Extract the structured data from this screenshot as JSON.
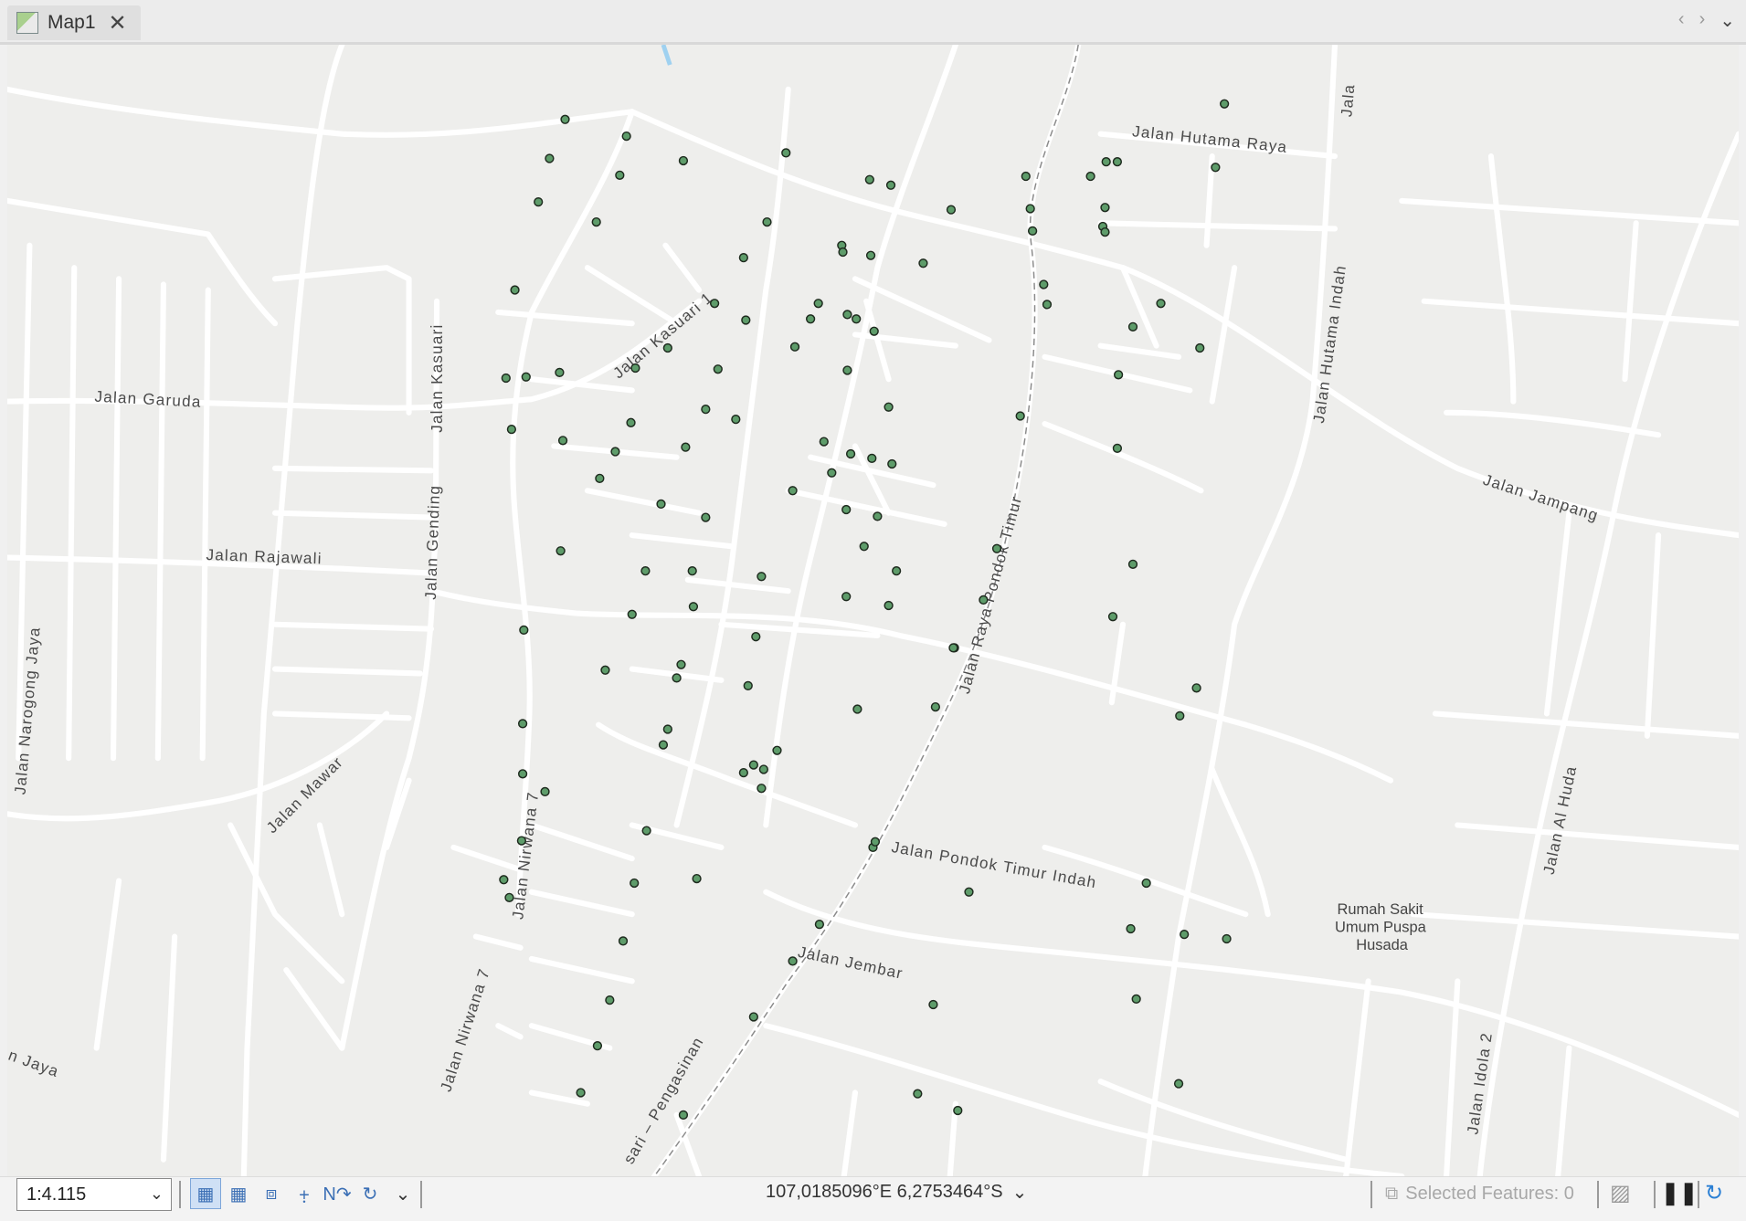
{
  "tab": {
    "title": "Map1"
  },
  "map": {
    "labels": {
      "jalan_hutama_raya": "Jalan Hutama Raya",
      "jala": "Jala",
      "jalan_hutama_indah": "Jalan Hutama Indah",
      "jalan_kasuari": "Jalan Kasuari",
      "jalan_garuda": "Jalan Garuda",
      "jalan_kasuari_1": "Jalan Kasuari 1",
      "jalan_gending": "Jalan Gending",
      "jalan_rajawali": "Jalan Rajawali",
      "jalan_narogong_jaya": "Jalan Narogong Jaya",
      "jalan_mawar": "Jalan Mawar",
      "jalan_nirwana_7_a": "Jalan Nirwana 7",
      "jalan_nirwana_7_b": "Jalan Nirwana 7",
      "jalan_raya_pondok_timur": "Jalan Raya Pondok Timur",
      "jalan_jampang": "Jalan Jampang",
      "jalan_al_huda": "Jalan Al Huda",
      "jalan_pondok_timur_indah": "Jalan Pondok Timur Indah",
      "rumah_sakit": "Rumah Sakit",
      "umum_puspa": "Umum Puspa",
      "husada": "Husada",
      "jalan_jembar": "Jalan Jembar",
      "jalan_idola_2": "Jalan Idola 2",
      "n_jaya": "n Jaya",
      "sari_pengasinan": "sari – Pengasinan"
    },
    "colors": {
      "background": "#eeeeec",
      "road": "#ffffff",
      "point_fill": "#5e9c6a",
      "point_stroke": "#1e2a1e",
      "railway": "#8a8a8a"
    }
  },
  "status": {
    "scale": "1:4.115",
    "coordinates": "107,0185096°E 6,2753464°S",
    "selected_features": "Selected Features: 0"
  }
}
